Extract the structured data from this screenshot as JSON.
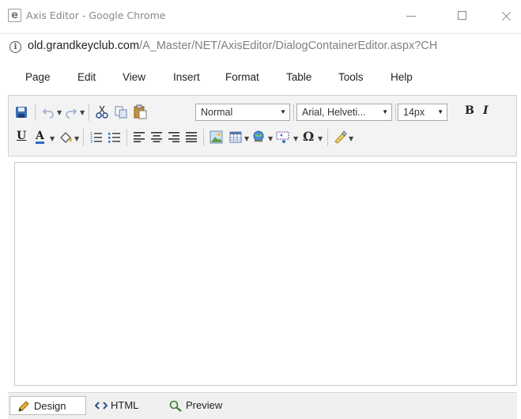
{
  "window": {
    "title": "Axis Editor - Google Chrome",
    "app_icon_glyph": "e"
  },
  "address": {
    "host": "old.grandkeyclub.com",
    "path": "/A_Master/NET/AxisEditor/DialogContainerEditor.aspx?CH",
    "info_glyph": "i"
  },
  "menu": {
    "items": [
      "Page",
      "Edit",
      "View",
      "Insert",
      "Format",
      "Table",
      "Tools",
      "Help"
    ]
  },
  "toolbar": {
    "paragraph_format": "Normal",
    "font_name": "Arial, Helveti...",
    "font_size": "14px",
    "bold_glyph": "B",
    "italic_glyph": "I",
    "underline_glyph": "U",
    "font_color_glyph": "A",
    "special_char_glyph": "Ω"
  },
  "modes": {
    "design": "Design",
    "html": "HTML",
    "preview": "Preview"
  },
  "colors": {
    "accent_blue": "#2b6cc4",
    "toolbar_bg": "#f3f3f3",
    "modebar_bg": "#f0f0f0"
  }
}
